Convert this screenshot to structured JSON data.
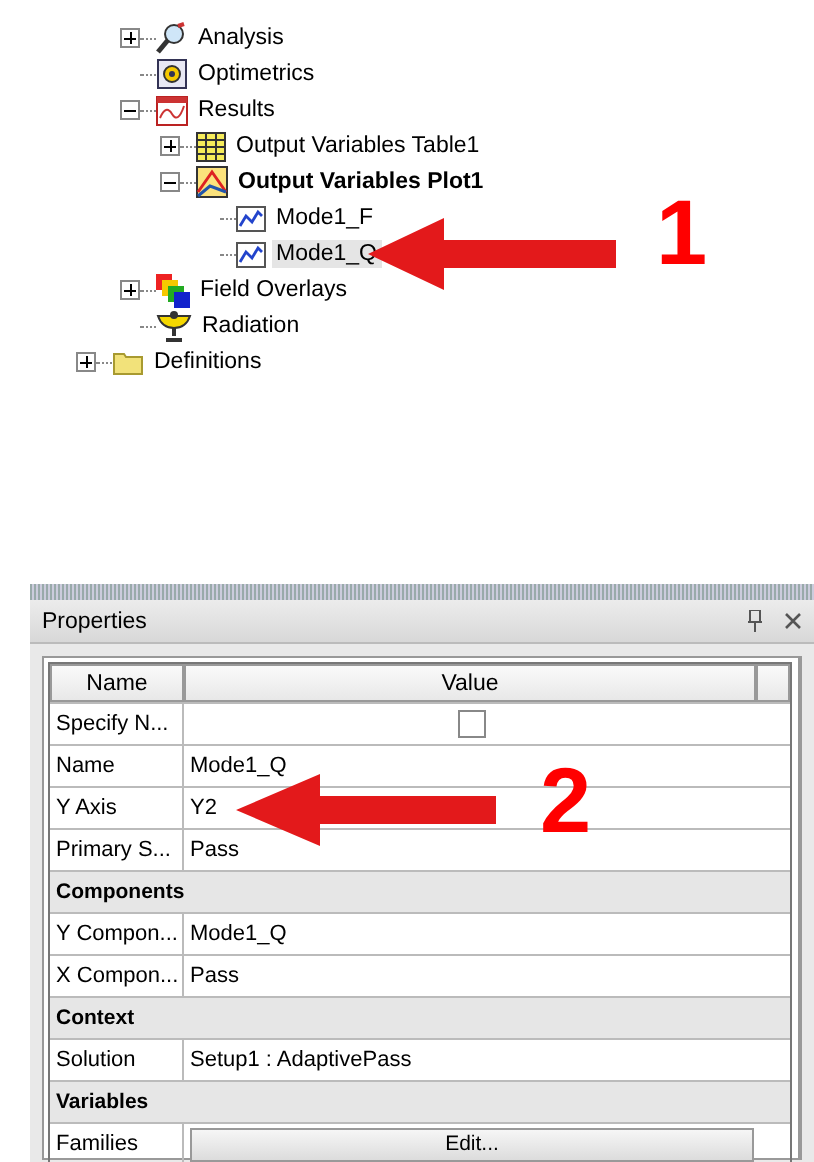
{
  "tree": [
    {
      "children": [
        {
          "label": "Analysis",
          "kind": "analysis",
          "expanded": false,
          "selected": false,
          "active": false
        },
        {
          "label": "Optimetrics",
          "kind": "optimetrics",
          "selected": false,
          "active": false
        },
        {
          "label": "Results",
          "kind": "results",
          "expanded": true,
          "selected": false,
          "active": false,
          "children": [
            {
              "label": "Output Variables Table1",
              "kind": "table",
              "expanded": false,
              "selected": false,
              "active": false
            },
            {
              "label": "Output Variables Plot1",
              "kind": "plot",
              "expanded": true,
              "selected": false,
              "active": true,
              "children": [
                {
                  "label": "Mode1_F",
                  "kind": "trace",
                  "selected": false,
                  "active": false
                },
                {
                  "label": "Mode1_Q",
                  "kind": "trace",
                  "selected": true,
                  "active": false
                }
              ]
            }
          ]
        },
        {
          "label": "Field Overlays",
          "kind": "overlays",
          "expanded": false,
          "selected": false,
          "active": false
        },
        {
          "label": "Radiation",
          "kind": "radiation",
          "selected": false,
          "active": false
        }
      ]
    },
    {
      "label": "Definitions",
      "kind": "folder",
      "expanded": false,
      "selected": false,
      "active": false
    }
  ],
  "callouts": [
    {
      "label": "1"
    },
    {
      "label": "2"
    }
  ],
  "properties": {
    "title": "Properties",
    "columns": [
      "Name",
      "Value"
    ],
    "rows": [
      {
        "kind": "checkbox",
        "name": "Specify N...",
        "checked": false
      },
      {
        "kind": "text",
        "name": "Name",
        "value": "Mode1_Q"
      },
      {
        "kind": "text",
        "name": "Y Axis",
        "value": "Y2"
      },
      {
        "kind": "text",
        "name": "Primary S...",
        "value": "Pass"
      },
      {
        "kind": "section",
        "name": "Components"
      },
      {
        "kind": "text",
        "name": "Y Compon...",
        "value": "Mode1_Q"
      },
      {
        "kind": "text",
        "name": "X Compon...",
        "value": "Pass"
      },
      {
        "kind": "section",
        "name": "Context"
      },
      {
        "kind": "text",
        "name": "Solution",
        "value": "Setup1 : AdaptivePass"
      },
      {
        "kind": "section",
        "name": "Variables"
      },
      {
        "kind": "button",
        "name": "Families",
        "value": "Edit..."
      }
    ]
  }
}
